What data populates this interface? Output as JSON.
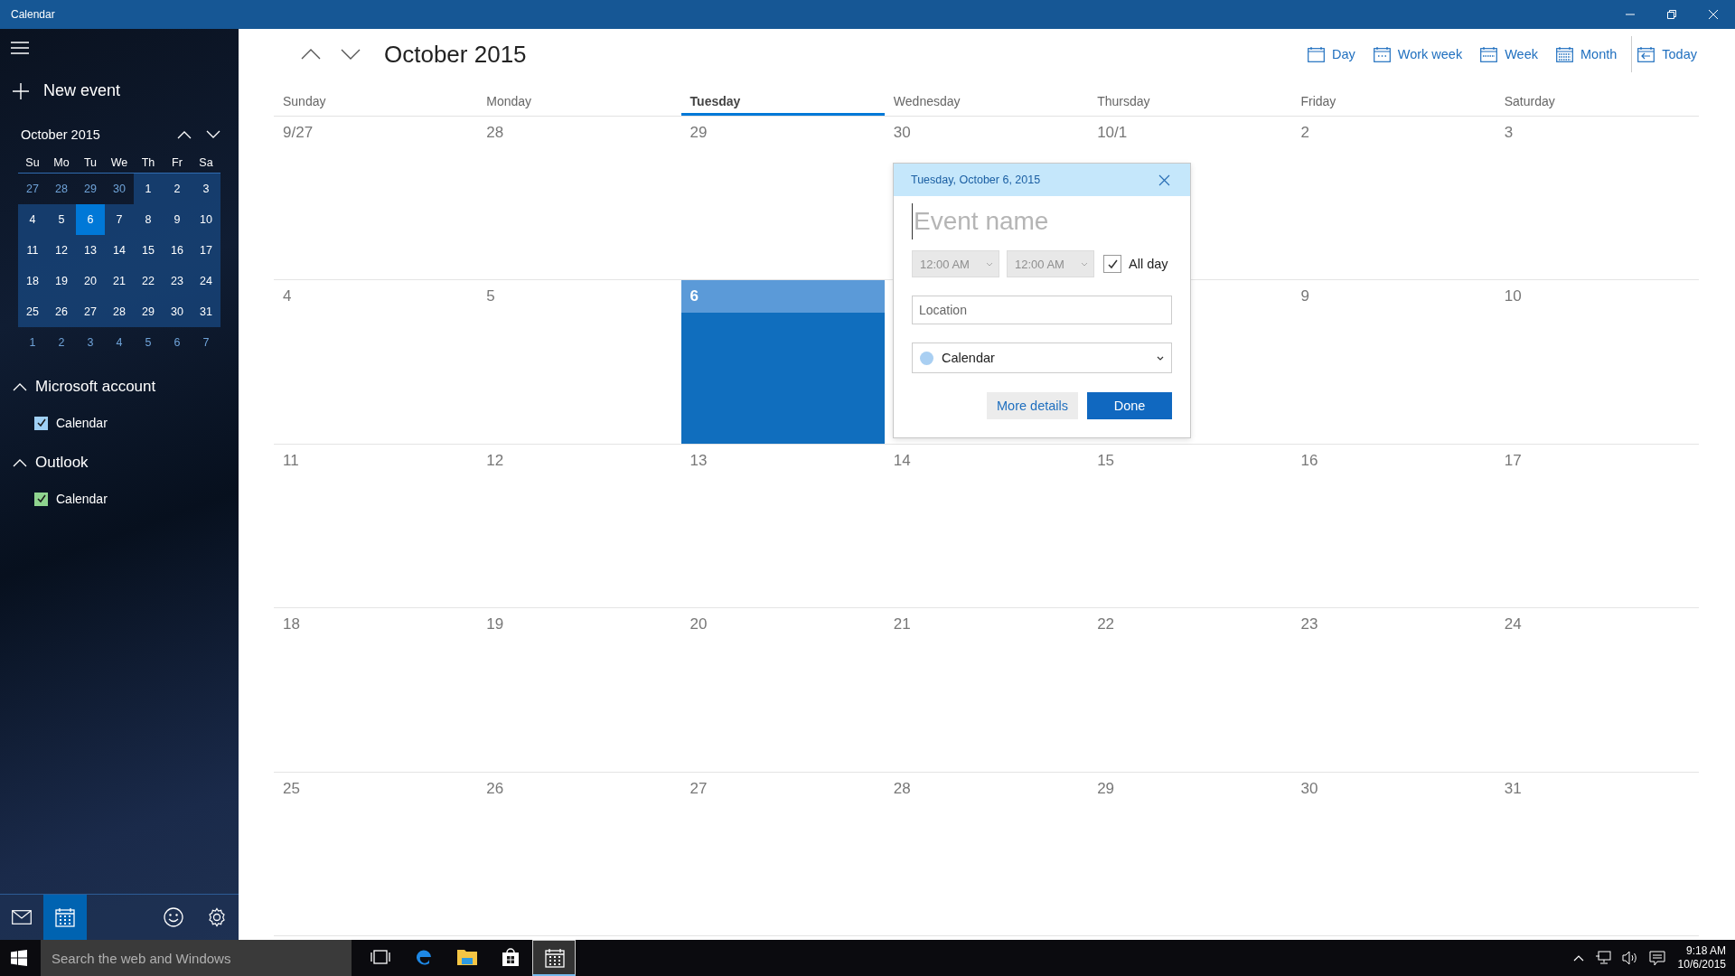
{
  "window": {
    "title": "Calendar"
  },
  "sidebar": {
    "new_event": "New event",
    "mini_calendar": {
      "title": "October 2015",
      "weekdays": [
        "Su",
        "Mo",
        "Tu",
        "We",
        "Th",
        "Fr",
        "Sa"
      ],
      "weeks": [
        [
          {
            "label": "27",
            "in_month": false,
            "selected": false
          },
          {
            "label": "28",
            "in_month": false,
            "selected": false
          },
          {
            "label": "29",
            "in_month": false,
            "selected": false
          },
          {
            "label": "30",
            "in_month": false,
            "selected": false
          },
          {
            "label": "1",
            "in_month": true,
            "selected": false
          },
          {
            "label": "2",
            "in_month": true,
            "selected": false
          },
          {
            "label": "3",
            "in_month": true,
            "selected": false
          }
        ],
        [
          {
            "label": "4",
            "in_month": true,
            "selected": false
          },
          {
            "label": "5",
            "in_month": true,
            "selected": false
          },
          {
            "label": "6",
            "in_month": true,
            "selected": true
          },
          {
            "label": "7",
            "in_month": true,
            "selected": false
          },
          {
            "label": "8",
            "in_month": true,
            "selected": false
          },
          {
            "label": "9",
            "in_month": true,
            "selected": false
          },
          {
            "label": "10",
            "in_month": true,
            "selected": false
          }
        ],
        [
          {
            "label": "11",
            "in_month": true,
            "selected": false
          },
          {
            "label": "12",
            "in_month": true,
            "selected": false
          },
          {
            "label": "13",
            "in_month": true,
            "selected": false
          },
          {
            "label": "14",
            "in_month": true,
            "selected": false
          },
          {
            "label": "15",
            "in_month": true,
            "selected": false
          },
          {
            "label": "16",
            "in_month": true,
            "selected": false
          },
          {
            "label": "17",
            "in_month": true,
            "selected": false
          }
        ],
        [
          {
            "label": "18",
            "in_month": true,
            "selected": false
          },
          {
            "label": "19",
            "in_month": true,
            "selected": false
          },
          {
            "label": "20",
            "in_month": true,
            "selected": false
          },
          {
            "label": "21",
            "in_month": true,
            "selected": false
          },
          {
            "label": "22",
            "in_month": true,
            "selected": false
          },
          {
            "label": "23",
            "in_month": true,
            "selected": false
          },
          {
            "label": "24",
            "in_month": true,
            "selected": false
          }
        ],
        [
          {
            "label": "25",
            "in_month": true,
            "selected": false
          },
          {
            "label": "26",
            "in_month": true,
            "selected": false
          },
          {
            "label": "27",
            "in_month": true,
            "selected": false
          },
          {
            "label": "28",
            "in_month": true,
            "selected": false
          },
          {
            "label": "29",
            "in_month": true,
            "selected": false
          },
          {
            "label": "30",
            "in_month": true,
            "selected": false
          },
          {
            "label": "31",
            "in_month": true,
            "selected": false
          }
        ],
        [
          {
            "label": "1",
            "in_month": false,
            "selected": false
          },
          {
            "label": "2",
            "in_month": false,
            "selected": false
          },
          {
            "label": "3",
            "in_month": false,
            "selected": false
          },
          {
            "label": "4",
            "in_month": false,
            "selected": false
          },
          {
            "label": "5",
            "in_month": false,
            "selected": false
          },
          {
            "label": "6",
            "in_month": false,
            "selected": false
          },
          {
            "label": "7",
            "in_month": false,
            "selected": false
          }
        ]
      ]
    },
    "accounts": [
      {
        "name": "Microsoft account",
        "expanded": true,
        "calendars": [
          {
            "name": "Calendar",
            "checked": true,
            "color": "#9fd0f5"
          }
        ]
      },
      {
        "name": "Outlook",
        "expanded": true,
        "calendars": [
          {
            "name": "Calendar",
            "checked": true,
            "color": "#8fd48f"
          }
        ]
      }
    ],
    "bottom_nav": [
      {
        "kind": "mail",
        "selected": false
      },
      {
        "kind": "calendar",
        "selected": true
      },
      {
        "kind": "feedback",
        "selected": false
      },
      {
        "kind": "settings",
        "selected": false
      }
    ]
  },
  "main": {
    "title": "October 2015",
    "views": [
      {
        "kind": "day",
        "label": "Day"
      },
      {
        "kind": "workweek",
        "label": "Work week"
      },
      {
        "kind": "week",
        "label": "Week"
      },
      {
        "kind": "month",
        "label": "Month"
      },
      {
        "kind": "today",
        "label": "Today"
      }
    ],
    "weekdays": [
      {
        "label": "Sunday",
        "selected": false
      },
      {
        "label": "Monday",
        "selected": false
      },
      {
        "label": "Tuesday",
        "selected": true
      },
      {
        "label": "Wednesday",
        "selected": false
      },
      {
        "label": "Thursday",
        "selected": false
      },
      {
        "label": "Friday",
        "selected": false
      },
      {
        "label": "Saturday",
        "selected": false
      }
    ],
    "weeks": [
      [
        {
          "label": "9/27",
          "selected": false
        },
        {
          "label": "28",
          "selected": false
        },
        {
          "label": "29",
          "selected": false
        },
        {
          "label": "30",
          "selected": false
        },
        {
          "label": "10/1",
          "selected": false
        },
        {
          "label": "2",
          "selected": false
        },
        {
          "label": "3",
          "selected": false
        }
      ],
      [
        {
          "label": "4",
          "selected": false
        },
        {
          "label": "5",
          "selected": false
        },
        {
          "label": "6",
          "selected": true
        },
        {
          "selected": false
        },
        {
          "selected": false
        },
        {
          "label": "9",
          "selected": false
        },
        {
          "label": "10",
          "selected": false
        }
      ],
      [
        {
          "label": "11",
          "selected": false
        },
        {
          "label": "12",
          "selected": false
        },
        {
          "label": "13",
          "selected": false
        },
        {
          "label": "14",
          "selected": false
        },
        {
          "label": "15",
          "selected": false
        },
        {
          "label": "16",
          "selected": false
        },
        {
          "label": "17",
          "selected": false
        }
      ],
      [
        {
          "label": "18",
          "selected": false
        },
        {
          "label": "19",
          "selected": false
        },
        {
          "label": "20",
          "selected": false
        },
        {
          "label": "21",
          "selected": false
        },
        {
          "label": "22",
          "selected": false
        },
        {
          "label": "23",
          "selected": false
        },
        {
          "label": "24",
          "selected": false
        }
      ],
      [
        {
          "label": "25",
          "selected": false
        },
        {
          "label": "26",
          "selected": false
        },
        {
          "label": "27",
          "selected": false
        },
        {
          "label": "28",
          "selected": false
        },
        {
          "label": "29",
          "selected": false
        },
        {
          "label": "30",
          "selected": false
        },
        {
          "label": "31",
          "selected": false
        }
      ]
    ]
  },
  "popup": {
    "date": "Tuesday, October 6, 2015",
    "event_name": {
      "placeholder": "Event name"
    },
    "start_time": {
      "value": "12:00 AM",
      "disabled": true
    },
    "end_time": {
      "value": "12:00 AM",
      "disabled": true
    },
    "all_day": {
      "label": "All day",
      "checked": true
    },
    "location": {
      "placeholder": "Location"
    },
    "calendar": {
      "value": "Calendar",
      "color": "#a9cff2"
    },
    "buttons": [
      {
        "kind": "secondary",
        "label": "More details"
      },
      {
        "kind": "primary",
        "label": "Done"
      }
    ]
  },
  "taskbar": {
    "search": {
      "placeholder": "Search the web and Windows"
    },
    "apps": [
      {
        "kind": "taskview",
        "selected": false
      },
      {
        "kind": "edge",
        "selected": false
      },
      {
        "kind": "explorer",
        "selected": false
      },
      {
        "kind": "store",
        "selected": false
      },
      {
        "kind": "calendar",
        "selected": true
      }
    ],
    "time": "9:18 AM",
    "date": "10/6/2015"
  }
}
